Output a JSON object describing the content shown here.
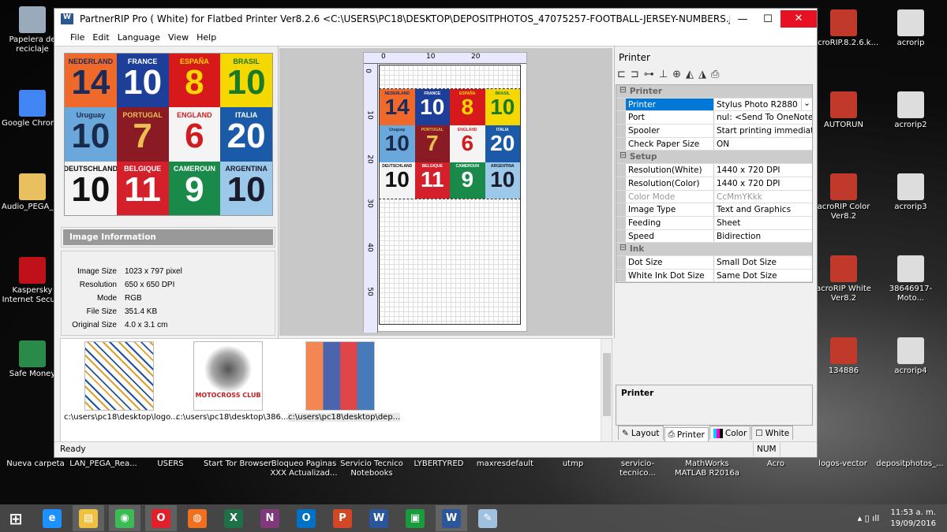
{
  "window": {
    "title": "PartnerRIP Pro ( White) for Flatbed Printer Ver8.2.6 <C:\\USERS\\PC18\\DESKTOP\\DEPOSITPHOTOS_47075257-FOOTBALL-JERSEY-NUMBERS.JPG>",
    "minimize": "—",
    "maximize": "☐",
    "close": "✕"
  },
  "menu": [
    "File",
    "Edit",
    "Language",
    "View",
    "Help"
  ],
  "jerseys": [
    {
      "country": "NEDERLAND",
      "number": "14",
      "bg": "#ef6a2a",
      "fg": "#1a2a5a"
    },
    {
      "country": "FRANCE",
      "number": "10",
      "bg": "#1d3f9a",
      "fg": "#ffffff"
    },
    {
      "country": "ESPAÑA",
      "number": "8",
      "bg": "#d7191c",
      "fg": "#ffd700"
    },
    {
      "country": "BRASIL",
      "number": "10",
      "bg": "#f5d800",
      "fg": "#1a7a2a"
    },
    {
      "country": "Uruguay",
      "number": "10",
      "bg": "#6aa8dc",
      "fg": "#1a2a4a"
    },
    {
      "country": "PORTUGAL",
      "number": "7",
      "bg": "#8a1a24",
      "fg": "#e8c050"
    },
    {
      "country": "ENGLAND",
      "number": "6",
      "bg": "#f4f4f4",
      "fg": "#d01c1f"
    },
    {
      "country": "ITALIA",
      "number": "20",
      "bg": "#1a5aa8",
      "fg": "#ffffff"
    },
    {
      "country": "DEUTSCHLAND",
      "number": "10",
      "bg": "#f4f4f4",
      "fg": "#111111"
    },
    {
      "country": "BELGIQUE",
      "number": "11",
      "bg": "#d4202a",
      "fg": "#ffffff"
    },
    {
      "country": "CAMEROUN",
      "number": "9",
      "bg": "#1a8a4a",
      "fg": "#ffffff"
    },
    {
      "country": "ARGENTINA",
      "number": "10",
      "bg": "#9cc8ea",
      "fg": "#1a1a2a"
    }
  ],
  "image_info": {
    "header": "Image Information",
    "rows": [
      {
        "label": "Image Size",
        "value": "1023 x 797 pixel"
      },
      {
        "label": "Resolution",
        "value": "650 x 650 DPI"
      },
      {
        "label": "Mode",
        "value": "RGB"
      },
      {
        "label": "File Size",
        "value": "351.4 KB"
      },
      {
        "label": "Original Size",
        "value": "4.0 x 3.1 cm"
      }
    ]
  },
  "ruler": {
    "h": [
      "0",
      "10",
      "20"
    ],
    "v": [
      "0",
      "10",
      "20",
      "30",
      "40",
      "50"
    ]
  },
  "thumbnails": [
    {
      "label": "c:\\users\\pc18\\desktop\\logo...",
      "selected": false
    },
    {
      "label": "c:\\users\\pc18\\desktop\\386...",
      "selected": false,
      "text": "MOTOCROSS CLUB"
    },
    {
      "label": "c:\\users\\pc18\\desktop\\dep...",
      "selected": true
    }
  ],
  "status": {
    "text": "Ready",
    "num": "NUM"
  },
  "right_panel": {
    "title": "Printer",
    "groups": [
      {
        "name": "Printer",
        "rows": [
          {
            "k": "Printer",
            "v": "Stylus Photo R2880",
            "selected": true
          },
          {
            "k": "Port",
            "v": "nul:    <Send To OneNote"
          },
          {
            "k": "Spooler",
            "v": "Start printing immediately"
          },
          {
            "k": "Check Paper Size",
            "v": "ON"
          }
        ]
      },
      {
        "name": "Setup",
        "rows": [
          {
            "k": "Resolution(White)",
            "v": "1440 x 720 DPI"
          },
          {
            "k": "Resolution(Color)",
            "v": "1440 x 720 DPI"
          },
          {
            "k": "Color Mode",
            "v": "CcMmYKkk",
            "disabled": true
          },
          {
            "k": "Image Type",
            "v": "Text and Graphics"
          },
          {
            "k": "Feeding",
            "v": "Sheet"
          },
          {
            "k": "Speed",
            "v": "Bidirection"
          }
        ]
      },
      {
        "name": "Ink",
        "rows": [
          {
            "k": "Dot Size",
            "v": "Small Dot Size"
          },
          {
            "k": "White Ink Dot Size",
            "v": "Same Dot Size"
          }
        ]
      }
    ],
    "description_title": "Printer",
    "tabs": [
      {
        "label": "Layout",
        "icon": "layout-icon"
      },
      {
        "label": "Printer",
        "icon": "printer-icon",
        "active": true
      },
      {
        "label": "Color",
        "icon": "color-icon"
      },
      {
        "label": "White",
        "icon": "white-icon"
      }
    ]
  },
  "desktop": {
    "left": [
      "Papelera de reciclaje",
      "Google Chrome",
      "Audio_PEGA_F...",
      "Kaspersky Internet Secu...",
      "Safe Money"
    ],
    "right1": [
      "acroRIP.8.2.6.k...",
      "AUTORUN",
      "acroRIP Color Ver8.2",
      "acroRIP White Ver8.2",
      "134886"
    ],
    "right2": [
      "acrorip",
      "acrorip2",
      "acrorip3",
      "38646917-Moto...",
      "acrorip4"
    ],
    "bottom": [
      "Nueva carpeta",
      "LAN_PEGA_Rea...",
      "USERS",
      "Start Tor Browser",
      "Bloqueo Paginas XXX Actualizad...",
      "Servicio Tecnico Notebooks",
      "LYBERTYRED",
      "maxresdefault",
      "utmp",
      "servicio-tecnico...",
      "MathWorks MATLAB R2016a",
      "Acro",
      "logos-vector",
      "depositphotos_..."
    ]
  },
  "taskbar": {
    "apps": [
      {
        "name": "internet-explorer",
        "glyph": "e",
        "color": "#1e90ff"
      },
      {
        "name": "file-explorer",
        "glyph": "▤",
        "color": "#f0c040"
      },
      {
        "name": "chrome",
        "glyph": "◉",
        "color": "#3cba54"
      },
      {
        "name": "opera",
        "glyph": "O",
        "color": "#e0202a"
      },
      {
        "name": "firefox",
        "glyph": "◍",
        "color": "#f07020"
      },
      {
        "name": "excel",
        "glyph": "X",
        "color": "#1e7145"
      },
      {
        "name": "onenote",
        "glyph": "N",
        "color": "#80397b"
      },
      {
        "name": "outlook",
        "glyph": "O",
        "color": "#0072c6"
      },
      {
        "name": "powerpoint",
        "glyph": "P",
        "color": "#d24726"
      },
      {
        "name": "word",
        "glyph": "W",
        "color": "#2b579a"
      },
      {
        "name": "store",
        "glyph": "▣",
        "color": "#1a9a3a"
      },
      {
        "name": "word-active",
        "glyph": "W",
        "color": "#2b579a"
      },
      {
        "name": "paint",
        "glyph": "✎",
        "color": "#a0c0e0"
      }
    ],
    "time": "11:53 a. m.",
    "date": "19/09/2016"
  }
}
